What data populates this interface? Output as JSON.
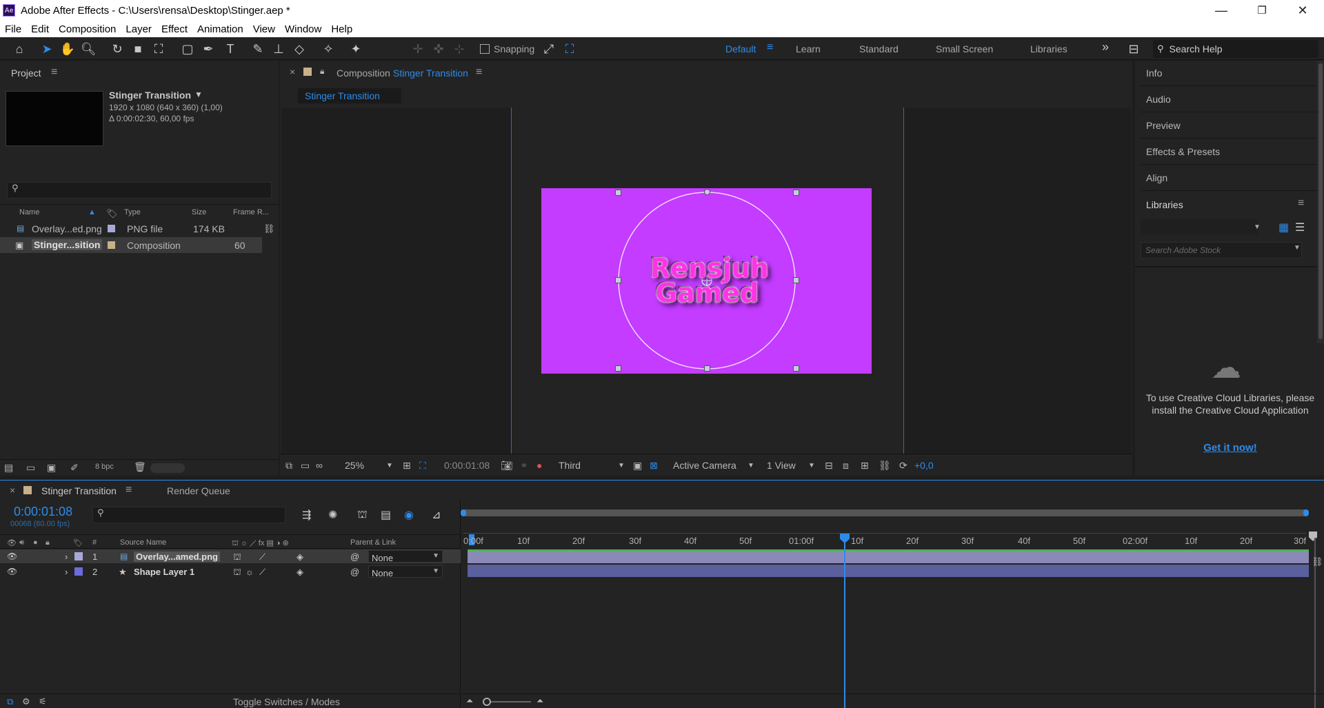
{
  "titlebar": {
    "app_icon": "Ae",
    "title": "Adobe After Effects - C:\\Users\\rensa\\Desktop\\Stinger.aep *",
    "minimize": "—",
    "restore": "❐",
    "close": "✕"
  },
  "menu": [
    "File",
    "Edit",
    "Composition",
    "Layer",
    "Effect",
    "Animation",
    "View",
    "Window",
    "Help"
  ],
  "toolbar": {
    "snapping_label": "Snapping",
    "workspaces": [
      "Default",
      "Learn",
      "Standard",
      "Small Screen",
      "Libraries"
    ],
    "active_workspace": "Default",
    "more": "»",
    "search_help_placeholder": "Search Help"
  },
  "project": {
    "title": "Project",
    "comp_name": "Stinger Transition",
    "comp_dims": "1920 x 1080  (640 x 360) (1,00)",
    "comp_duration": "Δ 0:00:02:30, 60,00 fps",
    "search_placeholder": "",
    "columns": {
      "name": "Name",
      "type": "Type",
      "size": "Size",
      "frame_rate": "Frame R..."
    },
    "items": [
      {
        "name": "Overlay...ed.png",
        "type": "PNG file",
        "size": "174 KB",
        "frame_rate": "",
        "label_color": "#a8a8d8"
      },
      {
        "name": "Stinger...sition",
        "type": "Composition",
        "size": "",
        "frame_rate": "60",
        "label_color": "#c8b08a"
      }
    ],
    "bpc": "8 bpc"
  },
  "composition": {
    "tab_prefix": "Composition",
    "tab_name": "Stinger Transition",
    "sub_tab": "Stinger Transition",
    "logo_line1": "Rensjuh",
    "logo_line2": "Gamed",
    "bg_color": "#c33cff",
    "viewer_bar": {
      "zoom": "25%",
      "timecode": "0:00:01:08",
      "resolution": "Third",
      "camera": "Active Camera",
      "views": "1 View",
      "exposure": "+0,0"
    }
  },
  "right_panels": {
    "items": [
      "Info",
      "Audio",
      "Preview",
      "Effects & Presets",
      "Align"
    ],
    "libraries_title": "Libraries",
    "stock_search_placeholder": "Search Adobe Stock",
    "cc_message": "To use Creative Cloud Libraries, please install the Creative Cloud Application",
    "get_it_link": "Get it now!"
  },
  "timeline": {
    "tab_name": "Stinger Transition",
    "render_queue": "Render Queue",
    "timecode": "0:00:01:08",
    "fps_info": "00068 (60.00 fps)",
    "search_placeholder": "",
    "columns": {
      "num": "#",
      "source_name": "Source Name",
      "parent": "Parent & Link"
    },
    "layers": [
      {
        "num": "1",
        "name": "Overlay...amed.png",
        "parent": "None",
        "label_color": "#a8a8d8",
        "bar_color": "#8b89b8"
      },
      {
        "num": "2",
        "name": "Shape Layer 1",
        "parent": "None",
        "label_color": "#6b6bdd",
        "bar_color": "#5a5f9e"
      }
    ],
    "ruler_labels": [
      "0:00f",
      "10f",
      "20f",
      "30f",
      "40f",
      "50f",
      "01:00f",
      "10f",
      "20f",
      "30f",
      "40f",
      "50f",
      "02:00f",
      "10f",
      "20f",
      "30f"
    ],
    "toggle_label": "Toggle Switches / Modes"
  }
}
